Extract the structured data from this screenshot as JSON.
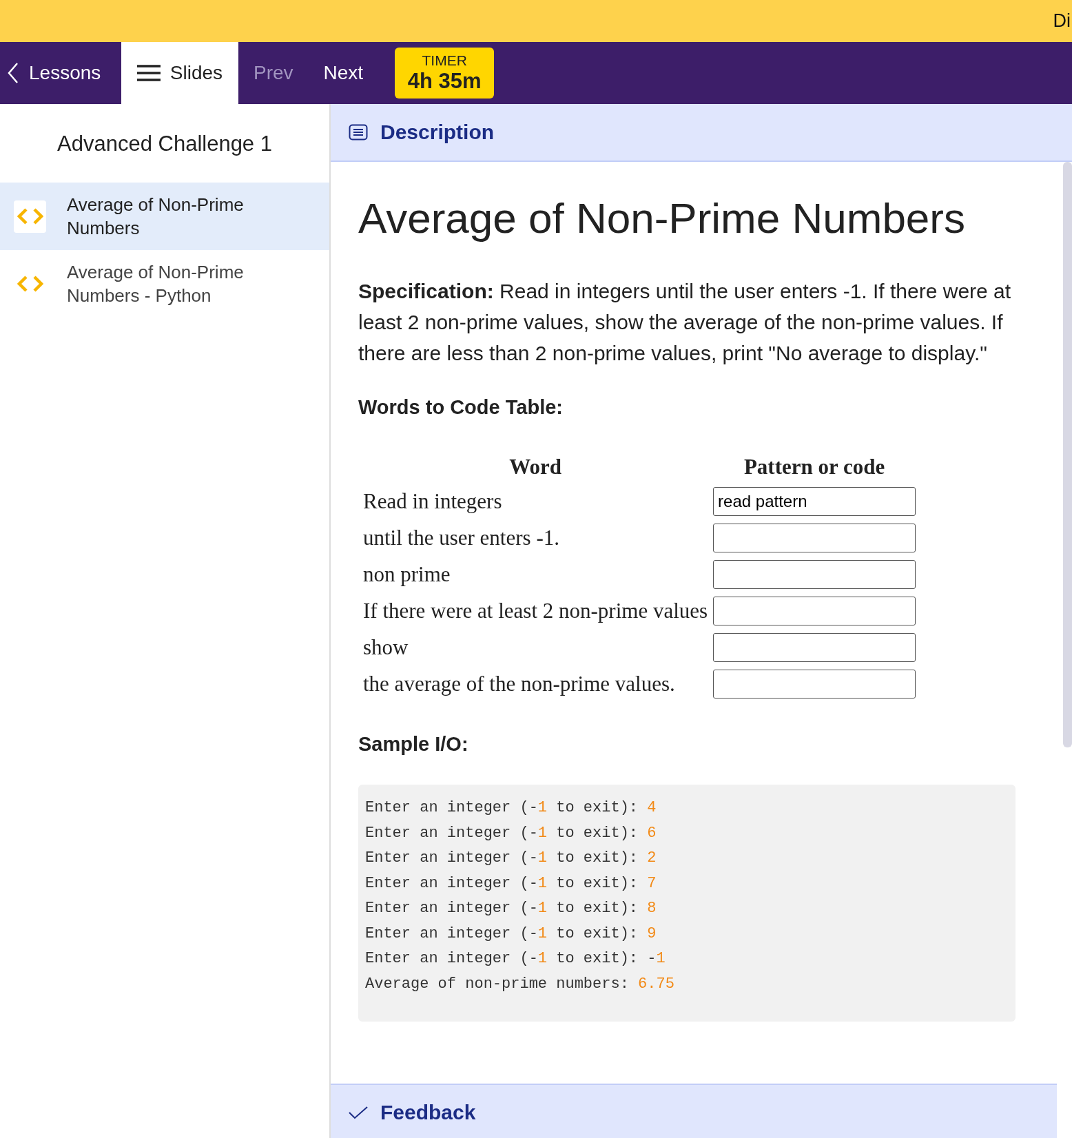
{
  "banner": {
    "text": "Di"
  },
  "nav": {
    "back": "Lessons",
    "slides": {
      "label": "Slides",
      "selected": true
    },
    "prev": {
      "label": "Prev",
      "disabled": true
    },
    "next": {
      "label": "Next",
      "disabled": false
    },
    "timer": {
      "label": "TIMER",
      "value": "4h 35m"
    }
  },
  "sidebar": {
    "title": "Advanced Challenge 1",
    "items": [
      {
        "label": "Average of Non-Prime Numbers",
        "selected": true
      },
      {
        "label": "Average of Non-Prime Numbers - Python",
        "selected": false
      }
    ]
  },
  "description": {
    "header": "Description",
    "title": "Average of Non-Prime Numbers",
    "specification": "**Specification:** Read in integers until the user enters -1. If there were at least 2 non-prime values, show the average of the non-prime values. If there are less than 2 non-prime values, print \"No average to display.\"",
    "table_heading": "Words to Code Table:",
    "table": {
      "columns": [
        "Word",
        "Pattern or code"
      ],
      "rows": [
        {
          "word": "Read in integers",
          "value": "read pattern"
        },
        {
          "word": "until the user enters -1."
        },
        {
          "word": "non prime"
        },
        {
          "word": "If there were at least 2 non-prime values"
        },
        {
          "word": "show"
        },
        {
          "word": "the average of the non-prime values."
        }
      ]
    },
    "sample_heading": "Sample I/O:",
    "sample_lines": [
      [
        {
          "text": "Enter an integer (-",
          "accent": false
        },
        {
          "text": "1",
          "accent": true
        },
        {
          "text": " to exit): ",
          "accent": false
        },
        {
          "text": "4",
          "accent": true
        }
      ],
      [
        {
          "text": "Enter an integer (-",
          "accent": false
        },
        {
          "text": "1",
          "accent": true
        },
        {
          "text": " to exit): ",
          "accent": false
        },
        {
          "text": "6",
          "accent": true
        }
      ],
      [
        {
          "text": "Enter an integer (-",
          "accent": false
        },
        {
          "text": "1",
          "accent": true
        },
        {
          "text": " to exit): ",
          "accent": false
        },
        {
          "text": "2",
          "accent": true
        }
      ],
      [
        {
          "text": "Enter an integer (-",
          "accent": false
        },
        {
          "text": "1",
          "accent": true
        },
        {
          "text": " to exit): ",
          "accent": false
        },
        {
          "text": "7",
          "accent": true
        }
      ],
      [
        {
          "text": "Enter an integer (-",
          "accent": false
        },
        {
          "text": "1",
          "accent": true
        },
        {
          "text": " to exit): ",
          "accent": false
        },
        {
          "text": "8",
          "accent": true
        }
      ],
      [
        {
          "text": "Enter an integer (-",
          "accent": false
        },
        {
          "text": "1",
          "accent": true
        },
        {
          "text": " to exit): ",
          "accent": false
        },
        {
          "text": "9",
          "accent": true
        }
      ],
      [
        {
          "text": "Enter an integer (-",
          "accent": false
        },
        {
          "text": "1",
          "accent": true
        },
        {
          "text": " to exit): -",
          "accent": false
        },
        {
          "text": "1",
          "accent": true
        }
      ],
      [
        {
          "text": "Average of non-prime numbers: ",
          "accent": false
        },
        {
          "text": "6.75",
          "accent": true
        }
      ]
    ]
  },
  "feedback": {
    "header": "Feedback"
  }
}
